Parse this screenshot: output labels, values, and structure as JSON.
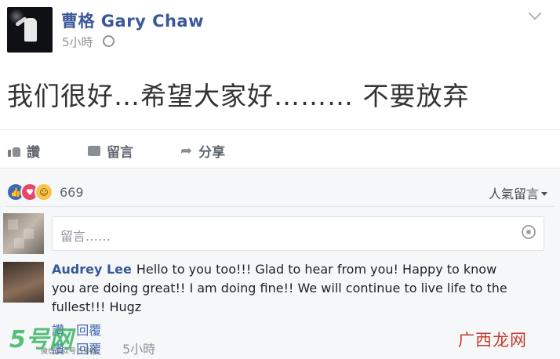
{
  "post": {
    "author": "曹格 Gary Chaw",
    "time": "5小時",
    "text": "我们很好…希望大家好……… 不要放弃"
  },
  "actions": {
    "like": "讚",
    "comment": "留言",
    "share": "分享"
  },
  "reactions": {
    "count": "669",
    "sort_label": "人氣留言"
  },
  "comment_input": {
    "placeholder": "留言……"
  },
  "comment": {
    "author": "Audrey Lee",
    "text": "Hello to you too!!! Glad to hear from you! Happy to know you are doing great!! I am doing fine!! We will continue to live life to the fullest!!! Hugz",
    "action1": "讚 · 回覆",
    "action2": "讚 · 回覆",
    "time": "5小時"
  },
  "watermarks": {
    "left": "5号网",
    "left_sub": "微信公众号 5号网",
    "right": "广西龙网"
  },
  "icons": {
    "like": "thumbs-up-icon",
    "comment": "comment-icon",
    "share": "share-arrow-icon",
    "privacy": "globe-icon",
    "menu": "chevron-down-icon",
    "camera": "camera-icon"
  }
}
